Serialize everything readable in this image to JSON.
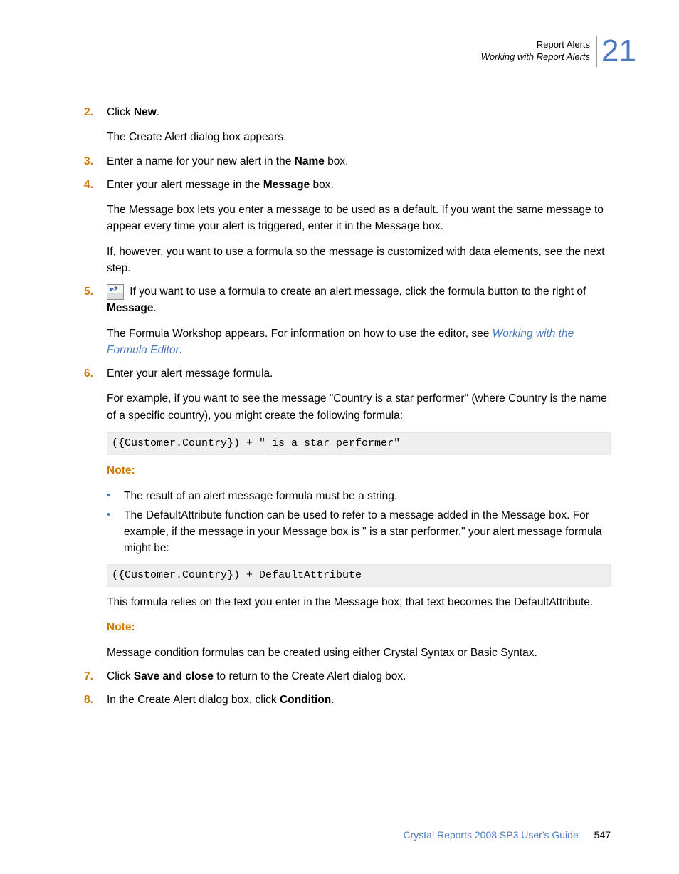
{
  "header": {
    "line1": "Report Alerts",
    "line2": "Working with Report Alerts",
    "chapter": "21"
  },
  "steps": {
    "s2": {
      "num": "2.",
      "text_a": "Click ",
      "text_b": "New",
      "text_c": ".",
      "sub": "The Create Alert dialog box appears."
    },
    "s3": {
      "num": "3.",
      "text_a": "Enter a name for your new alert in the ",
      "text_b": "Name",
      "text_c": " box."
    },
    "s4": {
      "num": "4.",
      "text_a": "Enter your alert message in the ",
      "text_b": "Message",
      "text_c": " box.",
      "sub1": "The Message box lets you enter a message to be used as a default. If you want the same message to appear every time your alert is triggered, enter it in the Message box.",
      "sub2": "If, however, you want to use a formula so the message is customized with data elements, see the next step."
    },
    "s5": {
      "num": "5.",
      "text_a": " If you want to use a formula to create an alert message, click the formula button to the right of ",
      "text_b": "Message",
      "text_c": ".",
      "sub_a": "The Formula Workshop appears. For information on how to use the editor, see ",
      "sub_b": "Working with the Formula Editor",
      "sub_c": "."
    },
    "s6": {
      "num": "6.",
      "text": "Enter your alert message formula.",
      "sub": "For example, if you want to see the message \"Country is a star performer\" (where Country is the name of a specific country), you might create the following formula:",
      "code1": "({Customer.Country}) + \" is a star performer\"",
      "note_label": "Note:",
      "bullet1": "The result of an alert message formula must be a string.",
      "bullet2": "The DefaultAttribute function can be used to refer to a message added in the Message box. For example, if the message in your Message box is \" is a star performer,\" your alert message formula might be:",
      "code2": "({Customer.Country}) + DefaultAttribute",
      "sub2": "This formula relies on the text you enter in the Message box; that text becomes the DefaultAttribute.",
      "note_label2": "Note:",
      "note2": "Message condition formulas can be created using either Crystal Syntax or Basic Syntax."
    },
    "s7": {
      "num": "7.",
      "text_a": "Click ",
      "text_b": "Save and close",
      "text_c": " to return to the Create Alert dialog box."
    },
    "s8": {
      "num": "8.",
      "text_a": "In the Create Alert dialog box, click ",
      "text_b": "Condition",
      "text_c": "."
    }
  },
  "footer": {
    "title": "Crystal Reports 2008 SP3 User's Guide",
    "page": "547"
  }
}
